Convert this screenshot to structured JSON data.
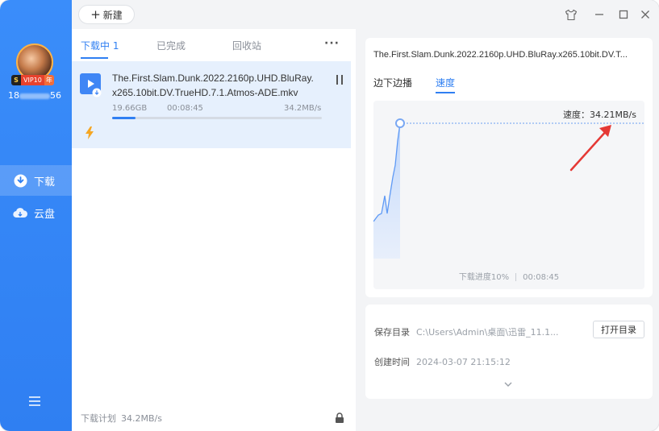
{
  "user": {
    "vip_mark": "S",
    "vip_label": "VIP10",
    "vip_year": "年",
    "id_prefix": "18",
    "id_suffix": "56"
  },
  "sidebar": {
    "items": [
      {
        "label": "下载",
        "icon": "download-icon",
        "active": true
      },
      {
        "label": "云盘",
        "icon": "cloud-icon",
        "active": false
      }
    ]
  },
  "toolbar": {
    "new_label": "新建",
    "new_icon": "plus-icon"
  },
  "list": {
    "tabs": [
      {
        "label": "下载中 1",
        "active": true
      },
      {
        "label": "已完成",
        "active": false
      },
      {
        "label": "回收站",
        "active": false
      }
    ],
    "more_label": "···",
    "task": {
      "name_line1": "The.First.Slam.Dunk.2022.2160p.UHD.BluRay.",
      "name_line2": "x265.10bit.DV.TrueHD.7.1.Atmos-ADE.mkv",
      "size": "19.66GB",
      "time": "00:08:45",
      "speed": "34.2MB/s",
      "progress": 0.11
    },
    "footer_label": "下载计划",
    "footer_speed": "34.2MB/s"
  },
  "detail": {
    "title": "The.First.Slam.Dunk.2022.2160p.UHD.BluRay.x265.10bit.DV.T...",
    "tabs": [
      {
        "label": "边下边播",
        "active": false
      },
      {
        "label": "速度",
        "active": true
      }
    ],
    "speed_text": "速度：34.21MB/s",
    "progress_text": "下载进度10%",
    "time_text": "00:08:45",
    "save_label": "保存目录",
    "save_path": "C:\\Users\\Admin\\桌面\\迅雷_11.1...",
    "open_dir_label": "打开目录",
    "created_label": "创建时间",
    "created_value": "2024-03-07 21:15:12"
  },
  "colors": {
    "accent": "#2f7ff2",
    "arrow": "#e53935",
    "bolt": "#f5a623"
  }
}
